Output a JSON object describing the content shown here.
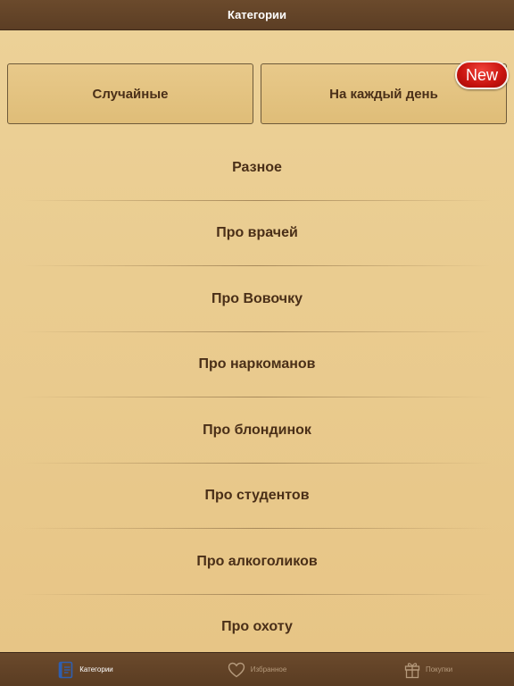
{
  "navbar": {
    "title": "Категории"
  },
  "top_buttons": {
    "random_label": "Случайные",
    "daily_label": "На каждый день",
    "new_badge": "New"
  },
  "categories": [
    {
      "label": "Разное"
    },
    {
      "label": "Про врачей"
    },
    {
      "label": "Про Вовочку"
    },
    {
      "label": "Про наркоманов"
    },
    {
      "label": "Про блондинок"
    },
    {
      "label": "Про студентов"
    },
    {
      "label": "Про алкоголиков"
    },
    {
      "label": "Про охоту"
    }
  ],
  "tabbar": {
    "tabs": [
      {
        "label": "Категории",
        "icon": "categories-icon",
        "active": true
      },
      {
        "label": "Избранное",
        "icon": "heart-icon",
        "active": false
      },
      {
        "label": "Покупки",
        "icon": "gift-icon",
        "active": false
      }
    ]
  },
  "colors": {
    "background": "#e9c88a",
    "bar": "#5c3e24",
    "text": "#4a2f18",
    "badge": "#c8140f",
    "active_icon": "#2f5fb0"
  }
}
